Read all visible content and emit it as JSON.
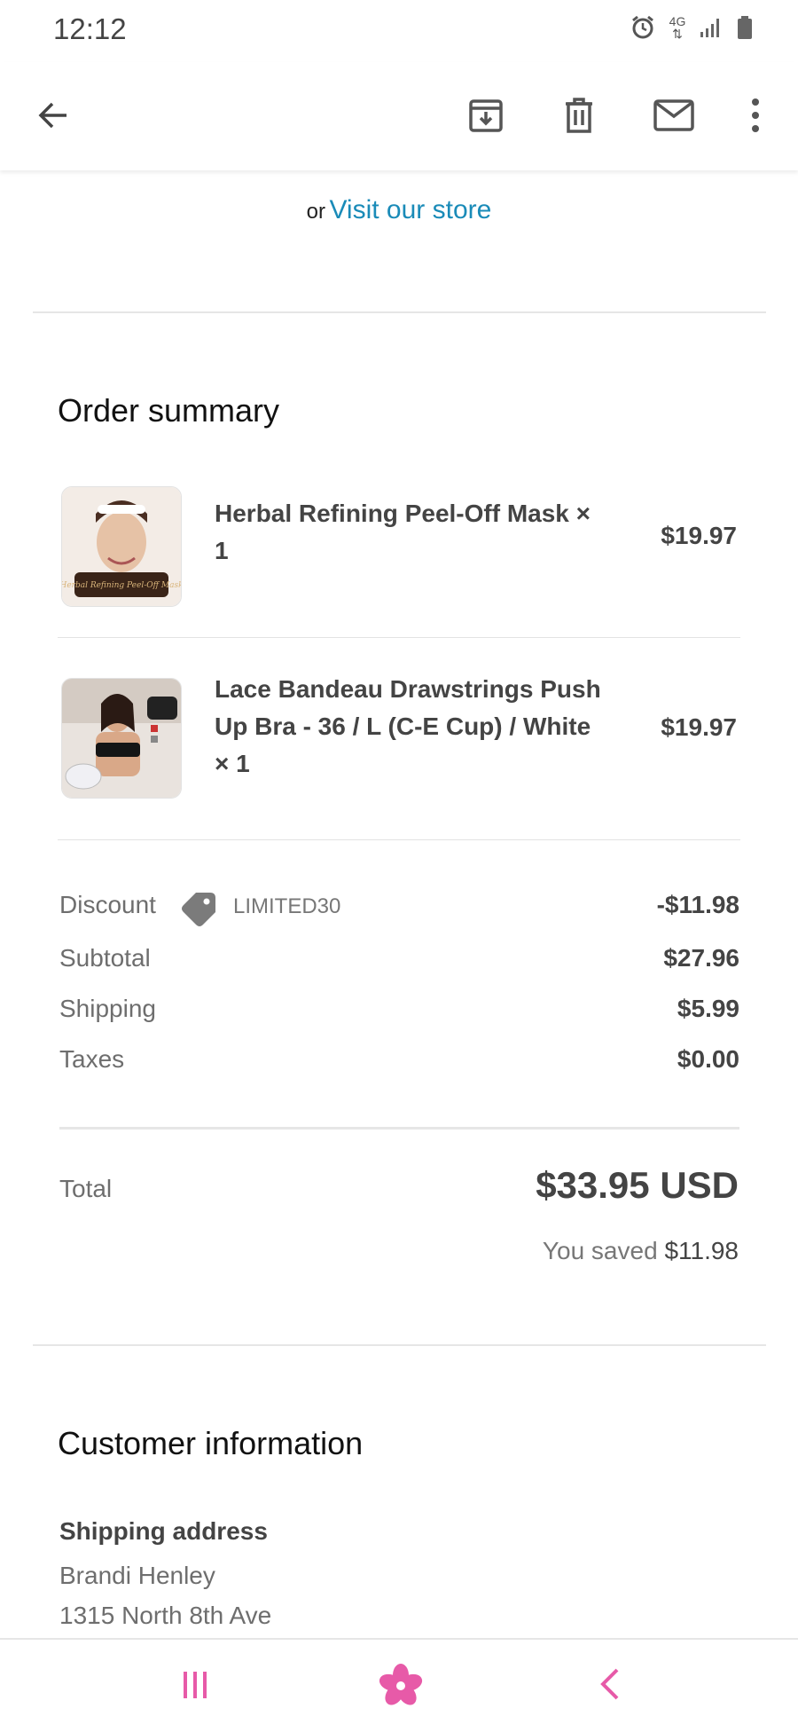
{
  "status": {
    "time": "12:12",
    "network": "4G"
  },
  "store": {
    "or": "or",
    "link": "Visit our store"
  },
  "order_summary": {
    "title": "Order summary",
    "items": [
      {
        "name": "Herbal Refining Peel-Off Mask × 1",
        "price": "$19.97",
        "thumb_caption": "Herbal Refining Peel-Off Mask"
      },
      {
        "name": "Lace Bandeau Drawstrings Push Up Bra - 36 / L (C-E Cup) / White × 1",
        "price": "$19.97"
      }
    ],
    "discount_label": "Discount",
    "discount_code": "LIMITED30",
    "discount_value": "-$11.98",
    "subtotal_label": "Subtotal",
    "subtotal_value": "$27.96",
    "shipping_label": "Shipping",
    "shipping_value": "$5.99",
    "taxes_label": "Taxes",
    "taxes_value": "$0.00",
    "total_label": "Total",
    "total_value": "$33.95 USD",
    "saved_label": "You saved",
    "saved_value": "$11.98"
  },
  "customer": {
    "title": "Customer information",
    "shipping_address_label": "Shipping address",
    "name": "Brandi Henley",
    "address_line1": "1315 North 8th Ave"
  },
  "colors": {
    "link": "#1a8bb8",
    "nav_accent": "#e75aa8"
  }
}
